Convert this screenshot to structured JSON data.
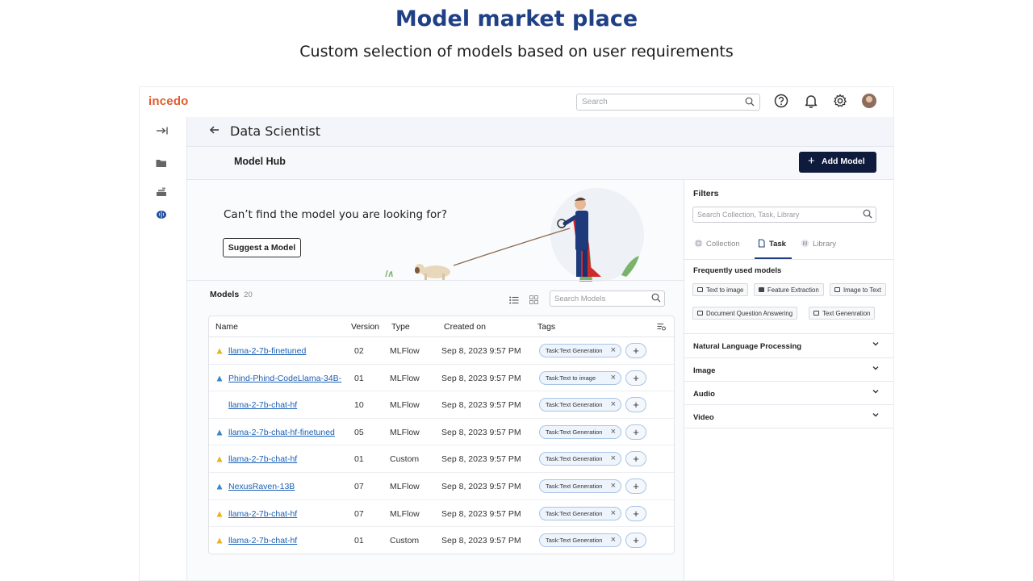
{
  "slide": {
    "title": "Model market place",
    "subtitle": "Custom selection of models based on user requirements"
  },
  "app": {
    "logo": "incedo",
    "search_placeholder": "Search",
    "icons": [
      "help-icon",
      "bell-icon",
      "gear-icon",
      "avatar"
    ],
    "sidebar_icons": [
      "collapse-icon",
      "folder-icon",
      "stack-icon",
      "brain-icon"
    ],
    "page_title": "Data Scientist",
    "hub_title": "Model Hub",
    "add_model_label": "Add Model",
    "promo": {
      "text": "Can’t find the model you are looking for?",
      "button": "Suggest a Model"
    },
    "models": {
      "label": "Models",
      "count": "20",
      "search_placeholder": "Search  Models",
      "columns": [
        "Name",
        "Version",
        "Type",
        "Created on",
        "Tags"
      ],
      "rows": [
        {
          "name": "llama-2-7b-finetuned",
          "version": "02",
          "type": "MLFlow",
          "created": "Sep 8, 2023 9:57 PM",
          "tag": "Task:Text Generation",
          "icon": "yellow"
        },
        {
          "name": "Phind-Phind-CodeLlama-34B-",
          "version": "01",
          "type": "MLFlow",
          "created": "Sep 8, 2023 9:57 PM",
          "tag": "Task:Text to image",
          "icon": "blue"
        },
        {
          "name": "llama-2-7b-chat-hf",
          "version": "10",
          "type": "MLFlow",
          "created": "Sep 8, 2023 9:57 PM",
          "tag": "Task:Text Generation",
          "icon": "none"
        },
        {
          "name": "llama-2-7b-chat-hf-finetuned",
          "version": "05",
          "type": "MLFlow",
          "created": "Sep 8, 2023 9:57 PM",
          "tag": "Task:Text Generation",
          "icon": "blue"
        },
        {
          "name": "llama-2-7b-chat-hf",
          "version": "01",
          "type": "Custom",
          "created": "Sep 8, 2023 9:57 PM",
          "tag": "Task:Text Generation",
          "icon": "yellow"
        },
        {
          "name": "NexusRaven-13B",
          "version": "07",
          "type": "MLFlow",
          "created": "Sep 8, 2023 9:57 PM",
          "tag": "Task:Text Generation",
          "icon": "blue"
        },
        {
          "name": "llama-2-7b-chat-hf",
          "version": "07",
          "type": "MLFlow",
          "created": "Sep 8, 2023 9:57 PM",
          "tag": "Task:Text Generation",
          "icon": "yellow"
        },
        {
          "name": "llama-2-7b-chat-hf",
          "version": "01",
          "type": "Custom",
          "created": "Sep 8, 2023 9:57 PM",
          "tag": "Task:Text Generation",
          "icon": "yellow"
        }
      ]
    },
    "filters": {
      "title": "Filters",
      "search_placeholder": "Search Collection, Task, Library",
      "tabs": [
        "Collection",
        "Task",
        "Library"
      ],
      "active_tab": "Task",
      "frequent_title": "Frequently used models",
      "chips": [
        "Text to image",
        "Feature Extraction",
        "Image to Text",
        "Document Question Answering",
        "Text Genenration"
      ],
      "sections": [
        "Natural Language Processing",
        "Image",
        "Audio",
        "Video"
      ]
    }
  },
  "colors": {
    "title_blue": "#1f3f86",
    "logo_orange": "#e35a2b",
    "button_navy": "#0f1b3d",
    "link_blue": "#1a5fb4",
    "icon_yellow": "#e8b317",
    "icon_blue": "#3a86c8"
  }
}
